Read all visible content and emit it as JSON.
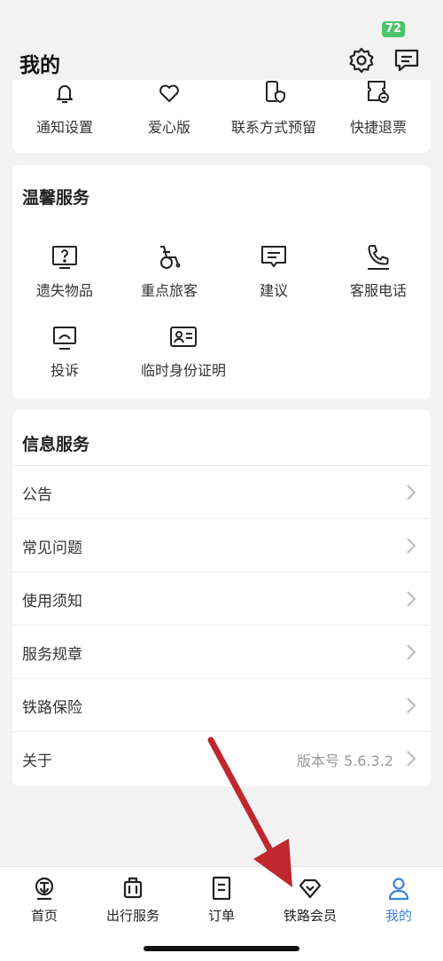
{
  "status_bar": {
    "battery": "72"
  },
  "header": {
    "title": "我的",
    "icons": [
      "gear-icon",
      "message-icon"
    ]
  },
  "top_grid": {
    "items": [
      {
        "label": "通知设置",
        "icon": "bell-icon"
      },
      {
        "label": "爱心版",
        "icon": "heart-icon"
      },
      {
        "label": "联系方式预留",
        "icon": "phone-shield-icon"
      },
      {
        "label": "快捷退票",
        "icon": "ticket-refund-icon"
      }
    ]
  },
  "warm_service": {
    "title": "温馨服务",
    "items": [
      {
        "label": "遗失物品",
        "icon": "question-box-icon"
      },
      {
        "label": "重点旅客",
        "icon": "wheelchair-icon"
      },
      {
        "label": "建议",
        "icon": "comment-icon"
      },
      {
        "label": "客服电话",
        "icon": "phone-icon"
      },
      {
        "label": "投诉",
        "icon": "complaint-icon"
      },
      {
        "label": "临时身份证明",
        "icon": "id-card-icon"
      }
    ]
  },
  "info_service": {
    "title": "信息服务",
    "rows": [
      {
        "label": "公告",
        "value": ""
      },
      {
        "label": "常见问题",
        "value": ""
      },
      {
        "label": "使用须知",
        "value": ""
      },
      {
        "label": "服务规章",
        "value": ""
      },
      {
        "label": "铁路保险",
        "value": ""
      },
      {
        "label": "关于",
        "value": "版本号 5.6.3.2"
      }
    ]
  },
  "tab_bar": {
    "tabs": [
      {
        "label": "首页",
        "icon": "railway-logo-icon",
        "active": false
      },
      {
        "label": "出行服务",
        "icon": "luggage-icon",
        "active": false
      },
      {
        "label": "订单",
        "icon": "order-icon",
        "active": false
      },
      {
        "label": "铁路会员",
        "icon": "diamond-icon",
        "active": false
      },
      {
        "label": "我的",
        "icon": "user-icon",
        "active": true
      }
    ]
  },
  "colors": {
    "accent": "#3b82d8",
    "battery": "#4cc46a",
    "arrow": "#c0282d"
  }
}
